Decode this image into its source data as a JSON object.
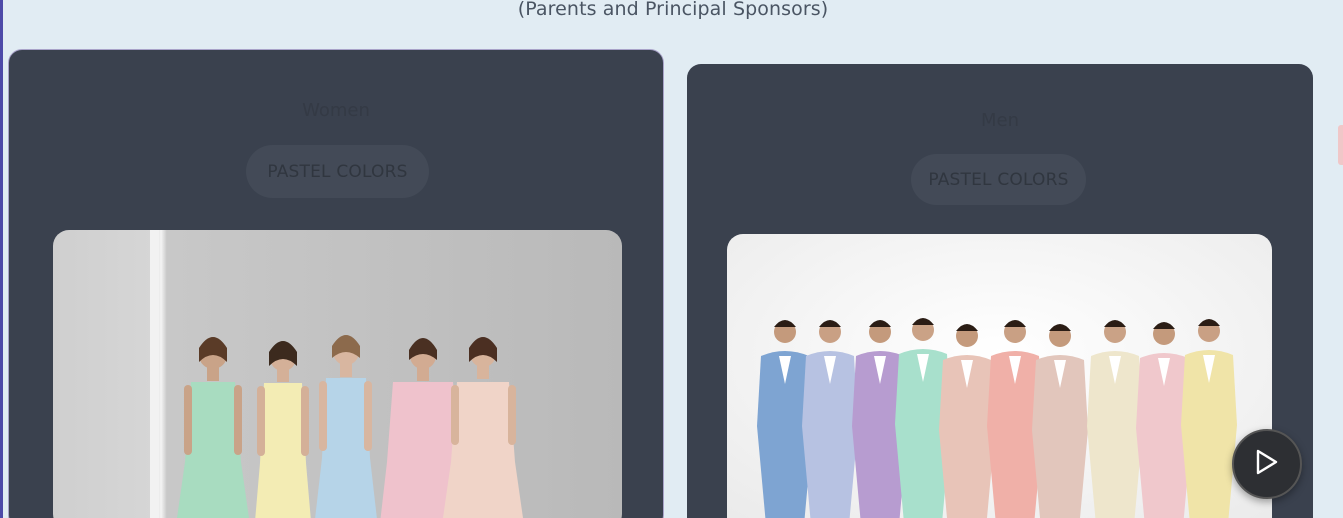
{
  "header": {
    "subtitle": "(Parents and Principal Sponsors)"
  },
  "cards": {
    "women": {
      "title": "Women",
      "pill": "PASTEL COLORS",
      "image_alt": "five-women-pastel-gowns"
    },
    "men": {
      "title": "Men",
      "pill": "PASTEL COLORS",
      "image_alt": "ten-men-pastel-suits"
    }
  },
  "colors": {
    "background": "#e1ecf3",
    "card": "#3a414e",
    "pill": "#434a57",
    "play_button": "#2d2f33",
    "gown_colors": [
      "#a8dcc0",
      "#f3ecb4",
      "#b6d4e8",
      "#efc2cc",
      "#f0d4c8"
    ],
    "suit_colors": [
      "#7ea4d2",
      "#b7c2e2",
      "#b79cd0",
      "#a8e0cc",
      "#e8c4b8",
      "#f0b0a8",
      "#e2c6bc",
      "#eee6cc",
      "#f0c8cc",
      "#f0e4a8"
    ]
  },
  "controls": {
    "play_icon": "play-icon"
  }
}
